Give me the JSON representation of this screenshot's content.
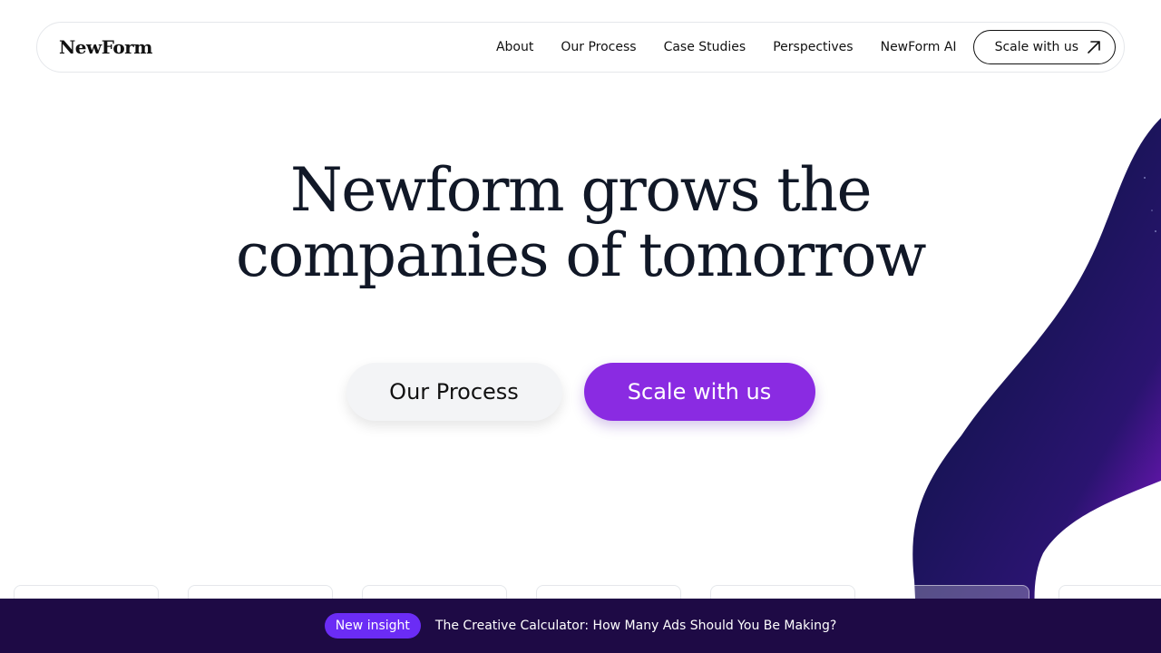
{
  "brand": {
    "name": "NewForm"
  },
  "nav": {
    "items": [
      {
        "label": "About"
      },
      {
        "label": "Our Process"
      },
      {
        "label": "Case Studies"
      },
      {
        "label": "Perspectives"
      },
      {
        "label": "NewForm AI"
      }
    ],
    "cta_label": "Scale with us",
    "cta_icon": "arrow-up-right-icon"
  },
  "hero": {
    "title_line1": "Newform grows the",
    "title_line2": "companies of tomorrow",
    "secondary_button": "Our Process",
    "primary_button": "Scale with us"
  },
  "insight": {
    "badge": "New insight",
    "text": "The Creative Calculator: How Many Ads Should You Be Making?"
  },
  "colors": {
    "accent": "#8a2be2",
    "badge": "#6b2cf5",
    "insight_bar": "#1e0a45",
    "swoosh_dark": "#1a1459",
    "swoosh_light": "#7b16c4",
    "text": "#111827"
  }
}
